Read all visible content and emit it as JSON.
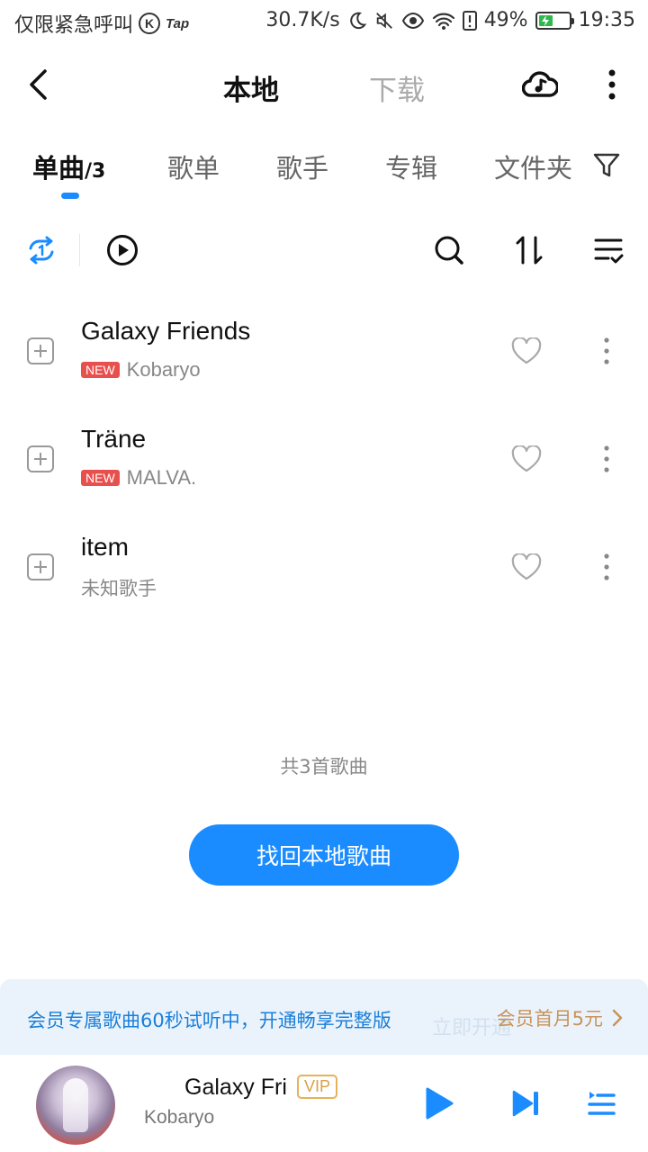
{
  "status_bar": {
    "left_text": "仅限紧急呼叫",
    "k_icon": "K",
    "tap_icon": "Tap",
    "net_speed": "30.7K/s",
    "battery_pct": "49%",
    "battery_level": 0.49,
    "time": "19:35"
  },
  "header": {
    "tab_local": "本地",
    "tab_download": "下载"
  },
  "category_tabs": {
    "songs": "单曲",
    "songs_count": "/3",
    "playlists": "歌单",
    "artists": "歌手",
    "albums": "专辑",
    "folders": "文件夹"
  },
  "songs": [
    {
      "title": "Galaxy Friends",
      "badge": "NEW",
      "artist": "Kobaryo"
    },
    {
      "title": "Träne",
      "badge": "NEW",
      "artist": "MALVA."
    },
    {
      "title": "item",
      "badge": "",
      "artist": "未知歌手"
    }
  ],
  "list_footer": {
    "total": "共3首歌曲",
    "recover_button": "找回本地歌曲"
  },
  "vip_banner": {
    "text": "会员专属歌曲60秒试听中，开通畅享完整版",
    "ghost_text": "立即开通",
    "offer": "会员首月5元"
  },
  "player": {
    "title": "Galaxy Friends",
    "vip_badge": "VIP",
    "artist": "Kobaryo"
  },
  "colors": {
    "accent": "#1a8cff",
    "new_badge": "#e8504e",
    "vip_gold": "#c99356",
    "battery_green": "#2fb84b"
  }
}
